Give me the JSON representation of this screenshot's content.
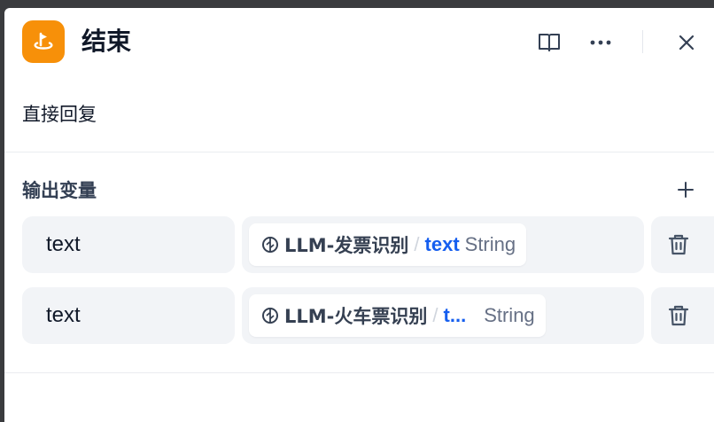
{
  "header": {
    "title": "结束",
    "icon": "end-node-icon",
    "accent": "#f79009",
    "tools": [
      "book-icon",
      "more-icon",
      "close-icon"
    ]
  },
  "description": "直接回复",
  "outputs": {
    "section_title": "输出变量",
    "add_icon": "plus-icon",
    "rows": [
      {
        "name": "text",
        "node": "LLM-发票识别",
        "separator": "/",
        "variable": "text",
        "type": "String"
      },
      {
        "name": "text",
        "node": "LLM-火车票识别",
        "separator": "/",
        "variable": "t...",
        "type": "String"
      }
    ]
  },
  "colors": {
    "variable": "#155eef",
    "field_bg": "#f2f4f7"
  }
}
